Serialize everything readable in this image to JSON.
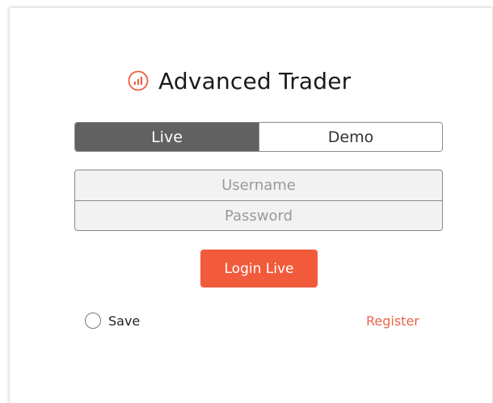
{
  "brand": {
    "title": "Advanced Trader",
    "icon": "bar-chart-circle-icon",
    "icon_color": "#f25a3c"
  },
  "mode_tabs": [
    {
      "label": "Live",
      "selected": true
    },
    {
      "label": "Demo",
      "selected": false
    }
  ],
  "form": {
    "username_placeholder": "Username",
    "username_value": "",
    "password_placeholder": "Password",
    "password_value": ""
  },
  "login_button": {
    "label": "Login Live",
    "color": "#f25a3c"
  },
  "save": {
    "label": "Save",
    "checked": false
  },
  "register": {
    "label": "Register",
    "color": "#e8654a"
  },
  "colors": {
    "active_tab": "#616161",
    "field_background": "#f2f2f2",
    "border": "#8a8a8a"
  }
}
